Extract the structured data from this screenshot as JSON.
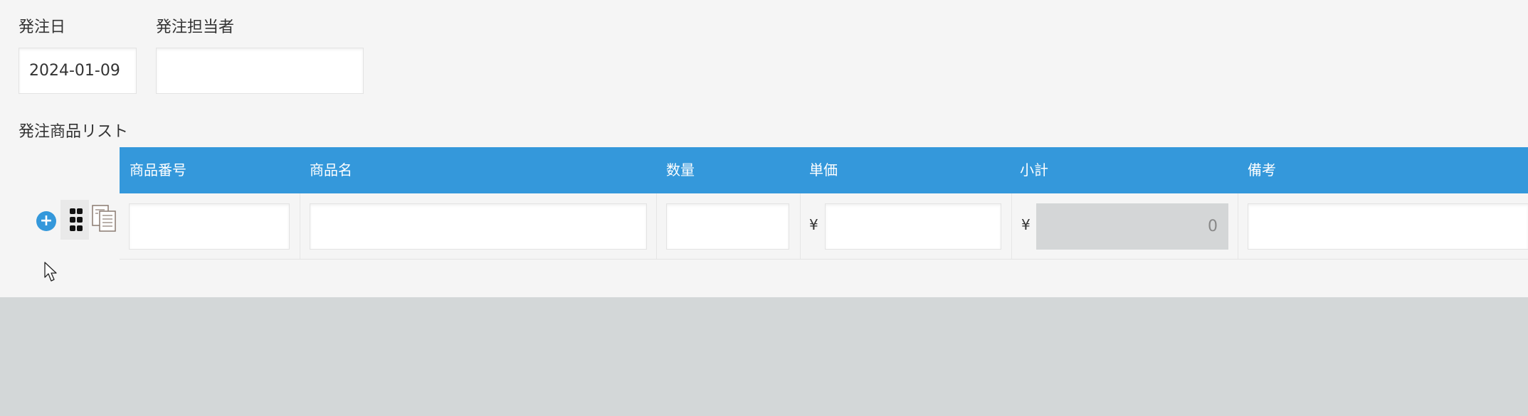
{
  "fields": {
    "order_date": {
      "label": "発注日",
      "value": "2024-01-09"
    },
    "order_person": {
      "label": "発注担当者",
      "value": ""
    }
  },
  "order_list": {
    "label": "発注商品リスト",
    "columns": [
      "商品番号",
      "商品名",
      "数量",
      "単価",
      "小計",
      "備考"
    ],
    "rows": [
      {
        "product_number": "",
        "product_name": "",
        "quantity": "",
        "unit_price": "",
        "subtotal": "0",
        "notes": ""
      }
    ],
    "currency_symbol": "¥"
  },
  "colors": {
    "header_bg": "#3498db",
    "form_bg": "#f5f5f5",
    "page_bg": "#d3d7d8",
    "subtotal_bg": "#d4d6d7"
  },
  "icons": {
    "add_row": "plus-circle-icon",
    "drag": "drag-handle-icon",
    "copy": "copy-icon",
    "cursor": "mouse-cursor-icon"
  }
}
